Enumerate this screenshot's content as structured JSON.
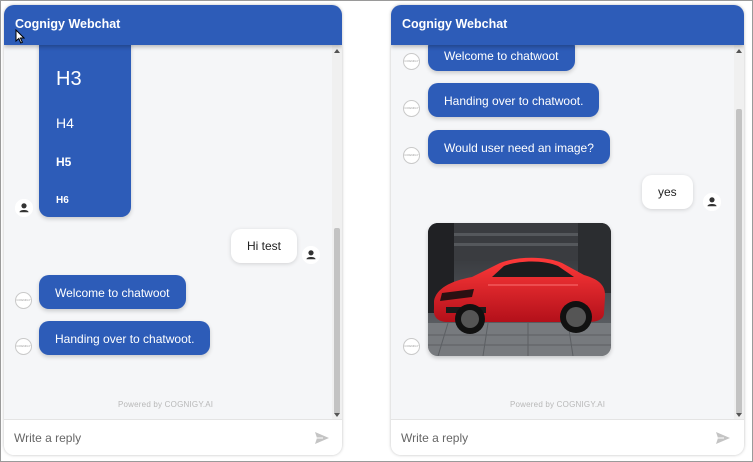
{
  "left_window": {
    "title": "Cognigy Webchat",
    "headings": [
      "H3",
      "H4",
      "H5",
      "H6"
    ],
    "messages": [
      {
        "from": "user",
        "text": "Hi test"
      },
      {
        "from": "bot",
        "text": "Welcome to chatwoot"
      },
      {
        "from": "bot",
        "text": "Handing over to chatwoot."
      }
    ],
    "powered_by": "Powered by COGNIGY.AI",
    "input_placeholder": "Write a reply"
  },
  "right_window": {
    "title": "Cognigy Webchat",
    "messages": [
      {
        "from": "bot",
        "text": "Welcome to chatwoot"
      },
      {
        "from": "bot",
        "text": "Handing over to chatwoot."
      },
      {
        "from": "bot",
        "text": "Would user need an image?"
      },
      {
        "from": "user",
        "text": "yes"
      }
    ],
    "image_message": "red-sports-car-photo",
    "powered_by": "Powered by COGNIGY.AI",
    "input_placeholder": "Write a reply"
  },
  "colors": {
    "brand_blue": "#2d5cb8",
    "background": "#f5f6f8"
  },
  "icons": [
    "user-avatar-icon",
    "bot-avatar-icon",
    "send-icon",
    "scroll-up-arrow-icon",
    "scroll-down-arrow-icon",
    "mouse-cursor-icon"
  ]
}
